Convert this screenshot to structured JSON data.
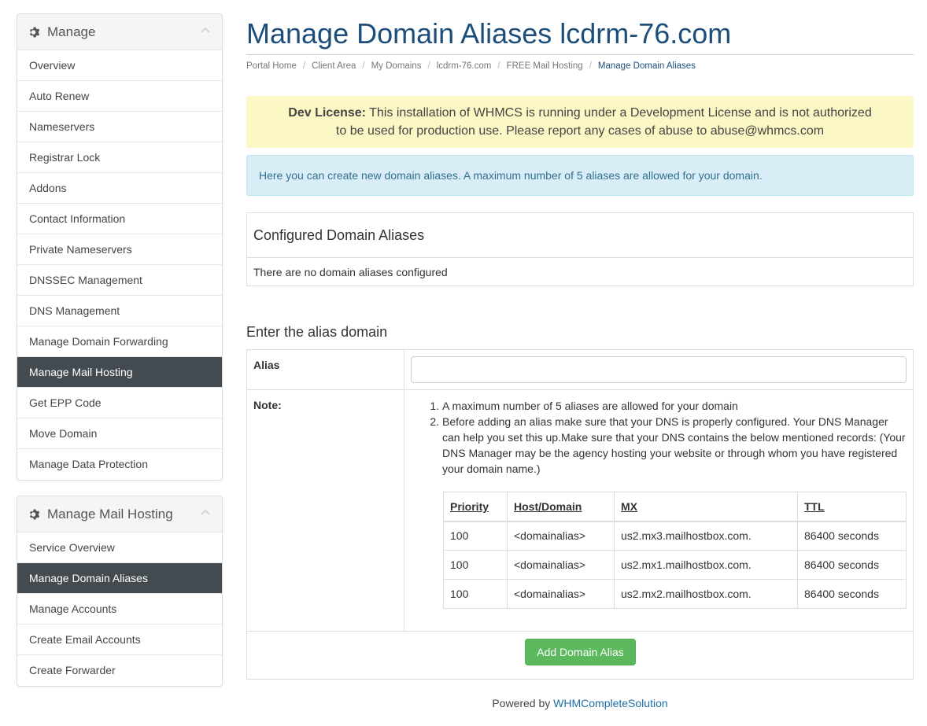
{
  "sidebar": {
    "manage": {
      "title": "Manage",
      "items": [
        {
          "label": "Overview"
        },
        {
          "label": "Auto Renew"
        },
        {
          "label": "Nameservers"
        },
        {
          "label": "Registrar Lock"
        },
        {
          "label": "Addons"
        },
        {
          "label": "Contact Information"
        },
        {
          "label": "Private Nameservers"
        },
        {
          "label": "DNSSEC Management"
        },
        {
          "label": "DNS Management"
        },
        {
          "label": "Manage Domain Forwarding"
        },
        {
          "label": "Manage Mail Hosting"
        },
        {
          "label": "Get EPP Code"
        },
        {
          "label": "Move Domain"
        },
        {
          "label": "Manage Data Protection"
        }
      ],
      "active_index": 10
    },
    "mail": {
      "title": "Manage Mail Hosting",
      "items": [
        {
          "label": "Service Overview"
        },
        {
          "label": "Manage Domain Aliases"
        },
        {
          "label": "Manage Accounts"
        },
        {
          "label": "Create Email Accounts"
        },
        {
          "label": "Create Forwarder"
        }
      ],
      "active_index": 1
    }
  },
  "page": {
    "title": "Manage Domain Aliases lcdrm-76.com",
    "breadcrumb": [
      "Portal Home",
      "Client Area",
      "My Domains",
      "lcdrm-76.com",
      "FREE Mail Hosting",
      "Manage Domain Aliases"
    ]
  },
  "alerts": {
    "dev_label": "Dev License:",
    "dev_text_1": " This installation of WHMCS is running under a Development License and is not authorized",
    "dev_text_2": "to be used for production use. Please report any cases of abuse to abuse@whmcs.com",
    "info": "Here you can create new domain aliases. A maximum number of 5 aliases are allowed for your domain."
  },
  "configured": {
    "heading": "Configured Domain Aliases",
    "empty": "There are no domain aliases configured"
  },
  "form": {
    "heading": "Enter the alias domain",
    "alias_label": "Alias",
    "alias_value": "",
    "note_label": "Note:",
    "notes": [
      "A maximum number of 5 aliases are allowed for your domain",
      "Before adding an alias make sure that your DNS is properly configured. Your DNS Manager can help you set this up.Make sure that your DNS contains the below mentioned records: (Your DNS Manager may be the agency hosting your website or through whom you have registered your domain name.)"
    ],
    "records_headers": [
      "Priority",
      "Host/Domain",
      "MX",
      "TTL"
    ],
    "records": [
      [
        "100",
        "<domainalias>",
        "us2.mx3.mailhostbox.com.",
        "86400 seconds"
      ],
      [
        "100",
        "<domainalias>",
        "us2.mx1.mailhostbox.com.",
        "86400 seconds"
      ],
      [
        "100",
        "<domainalias>",
        "us2.mx2.mailhostbox.com.",
        "86400 seconds"
      ]
    ],
    "submit_label": "Add Domain Alias"
  },
  "footer": {
    "prefix": "Powered by ",
    "link": "WHMCompleteSolution"
  },
  "icons": {
    "panel_heading": "gear-icon",
    "panel_toggle": "chevron-up-icon"
  },
  "colors": {
    "title": "#1d4e7a",
    "active_item_bg": "#434b51",
    "dev_alert_bg": "#fcf8c6",
    "info_alert_bg": "#d9edf7",
    "button_bg": "#5cb85c"
  }
}
